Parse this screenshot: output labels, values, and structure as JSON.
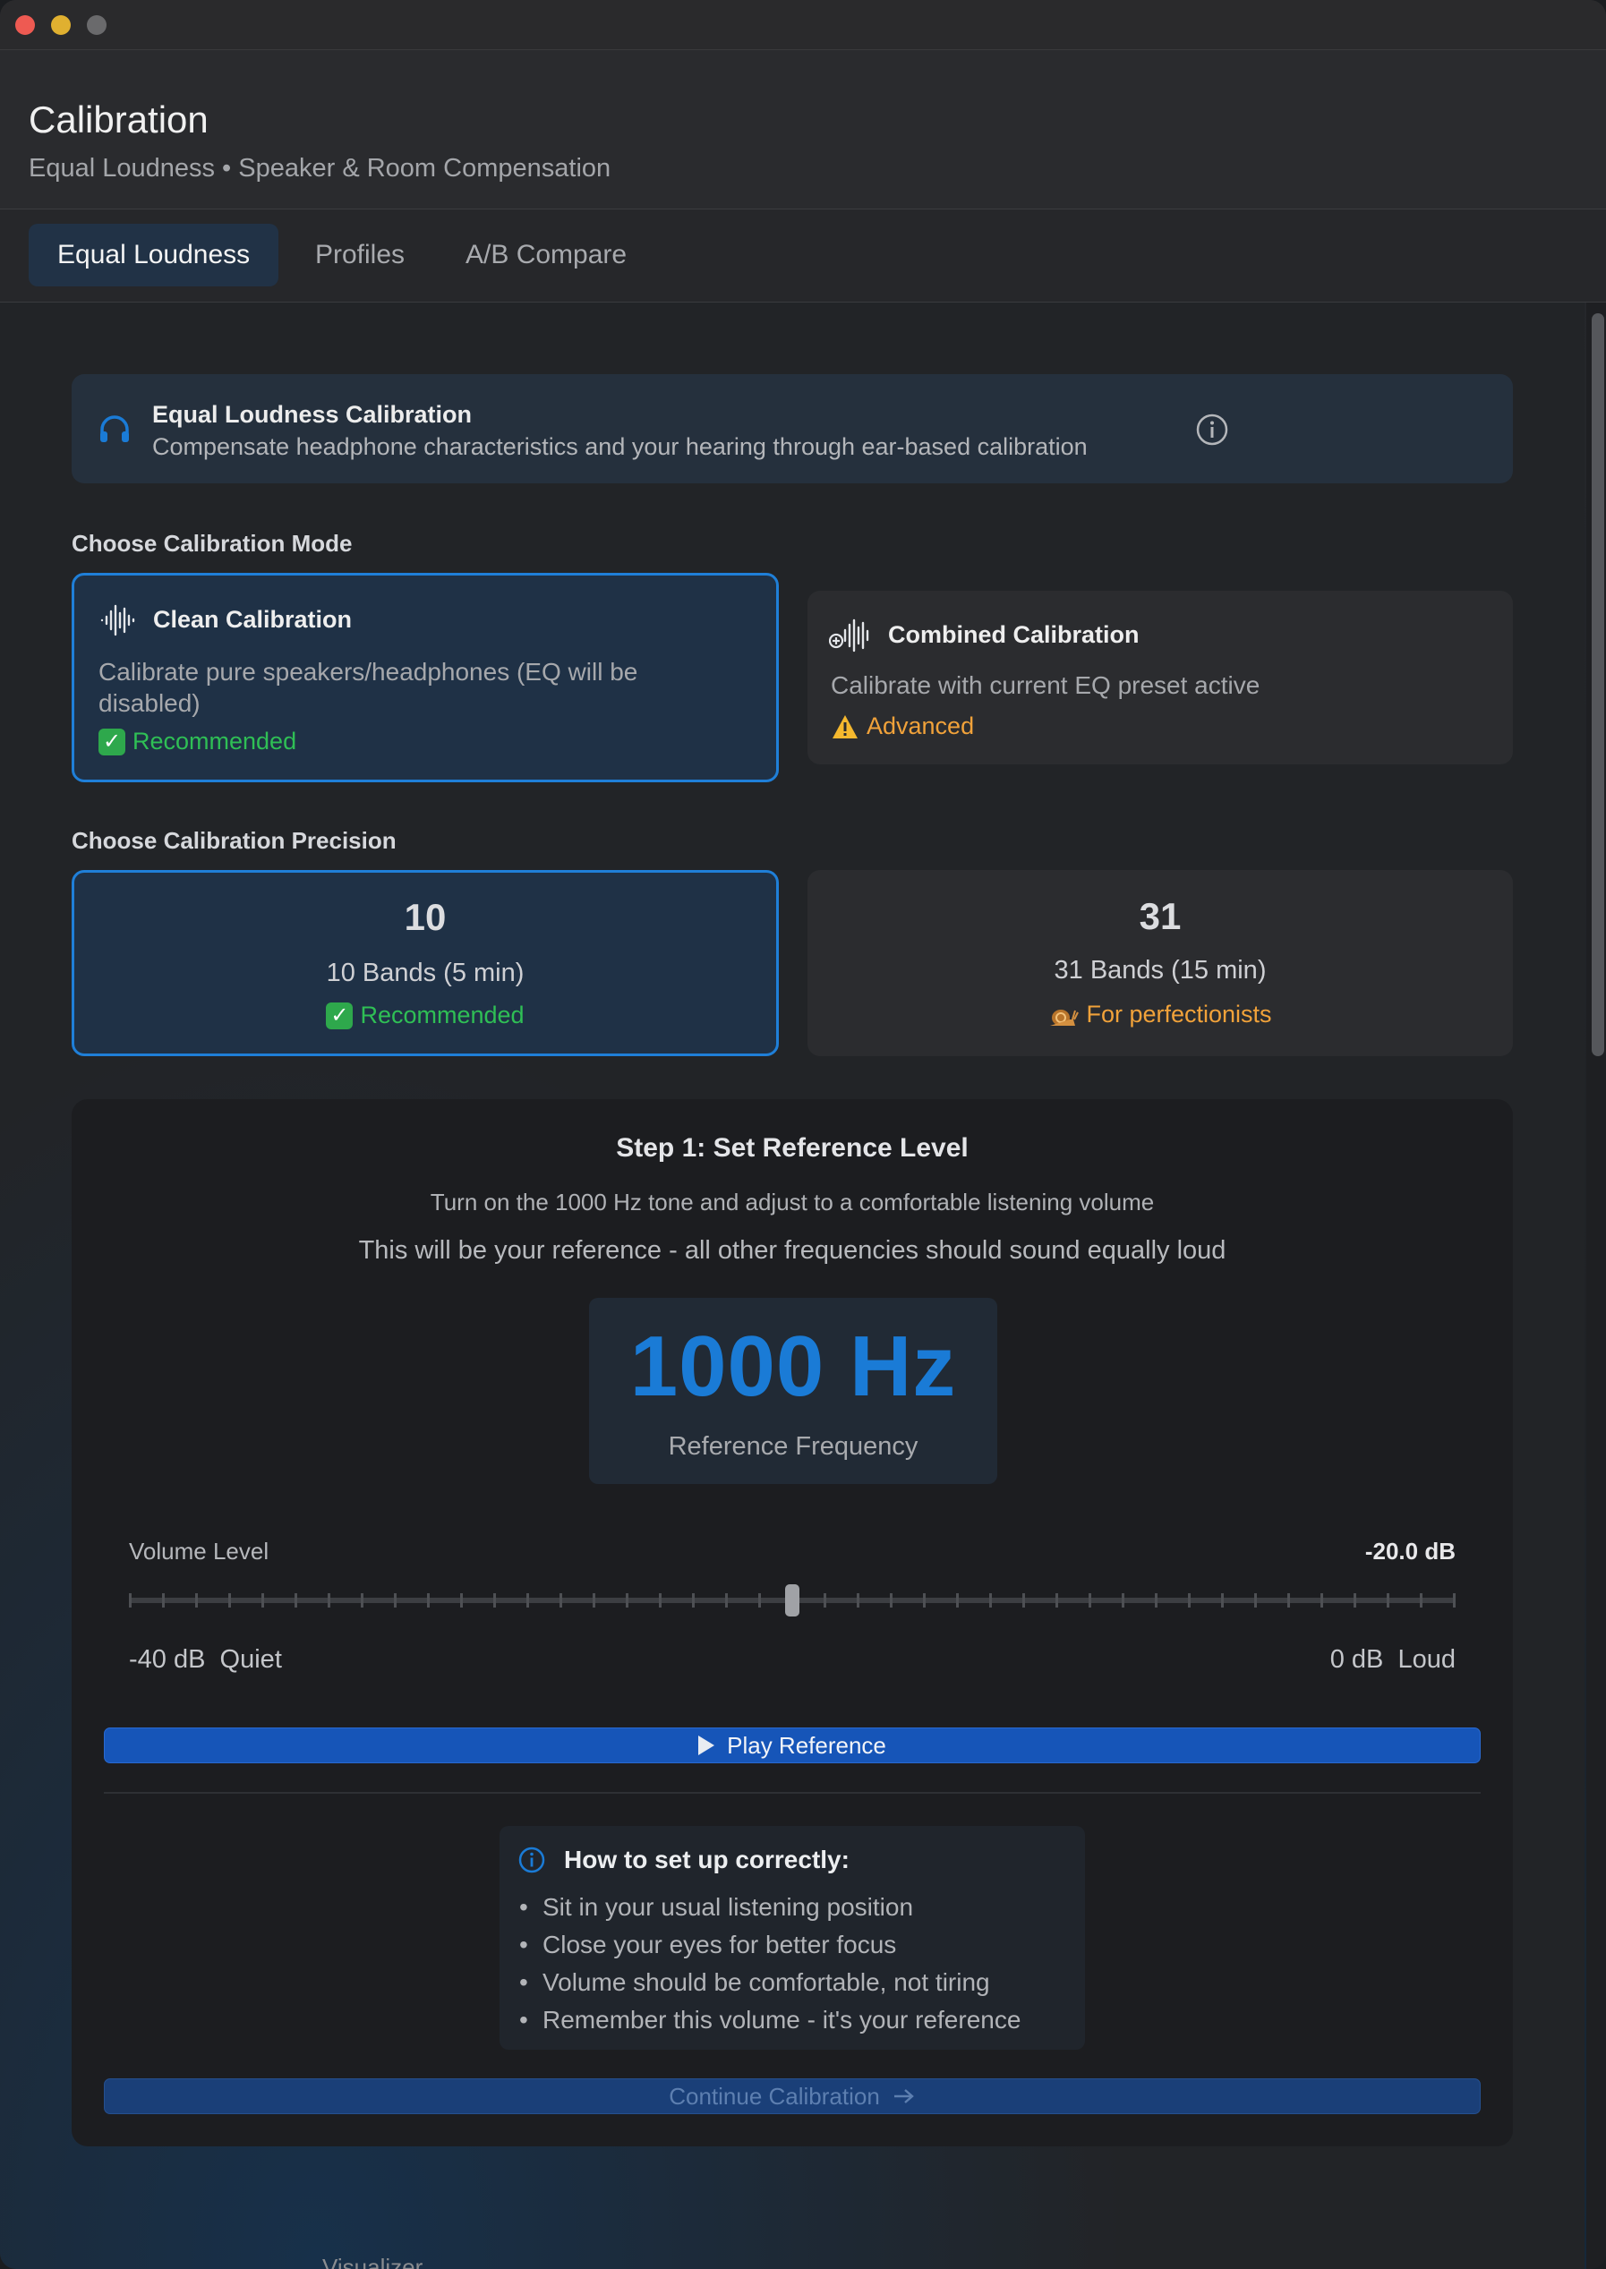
{
  "window": {
    "title": "Calibration",
    "subtitle": "Equal Loudness • Speaker & Room Compensation"
  },
  "tabs": [
    {
      "label": "Equal Loudness",
      "active": true
    },
    {
      "label": "Profiles",
      "active": false
    },
    {
      "label": "A/B Compare",
      "active": false
    }
  ],
  "banner": {
    "icon": "headphones-icon",
    "title": "Equal Loudness Calibration",
    "description": "Compensate headphone characteristics and your hearing through ear-based calibration",
    "info_icon": "info-icon"
  },
  "mode_section": {
    "label": "Choose Calibration Mode",
    "options": [
      {
        "icon": "waveform-icon",
        "title": "Clean Calibration",
        "description": "Calibrate pure speakers/headphones (EQ will be disabled)",
        "tag": "Recommended",
        "tag_icon": "check-icon",
        "selected": true
      },
      {
        "icon": "waveform-plus-icon",
        "title": "Combined Calibration",
        "description": "Calibrate with current EQ preset active",
        "tag": "Advanced",
        "tag_icon": "warning-icon",
        "selected": false
      }
    ]
  },
  "precision_section": {
    "label": "Choose Calibration Precision",
    "options": [
      {
        "number": "10",
        "description": "10 Bands (5 min)",
        "tag": "Recommended",
        "tag_icon": "check-icon",
        "selected": true
      },
      {
        "number": "31",
        "description": "31 Bands (15 min)",
        "tag": "For perfectionists",
        "tag_icon": "snail-icon",
        "selected": false
      }
    ]
  },
  "step": {
    "title": "Step 1: Set Reference Level",
    "instruction": "Turn on the 1000 Hz tone and adjust to a comfortable listening volume",
    "note": "This will be your reference - all other frequencies should sound equally loud",
    "frequency": "1000 Hz",
    "frequency_label": "Reference Frequency",
    "volume_label": "Volume Level",
    "volume_value": "-20.0 dB",
    "volume_fraction": 0.5,
    "min_label": "-40 dB  Quiet",
    "max_label": "0 dB  Loud",
    "play_label": "Play Reference",
    "tips_title": "How to set up correctly:",
    "tips": [
      "Sit in your usual listening position",
      "Close your eyes for better focus",
      "Volume should be comfortable, not tiring",
      "Remember this volume - it's your reference"
    ],
    "continue_label": "Continue Calibration",
    "continue_enabled": false
  },
  "background_peek": "Visualizer",
  "colors": {
    "accent": "#1a7bd6",
    "recommended": "#2fbf55",
    "warning": "#f1a23a"
  }
}
